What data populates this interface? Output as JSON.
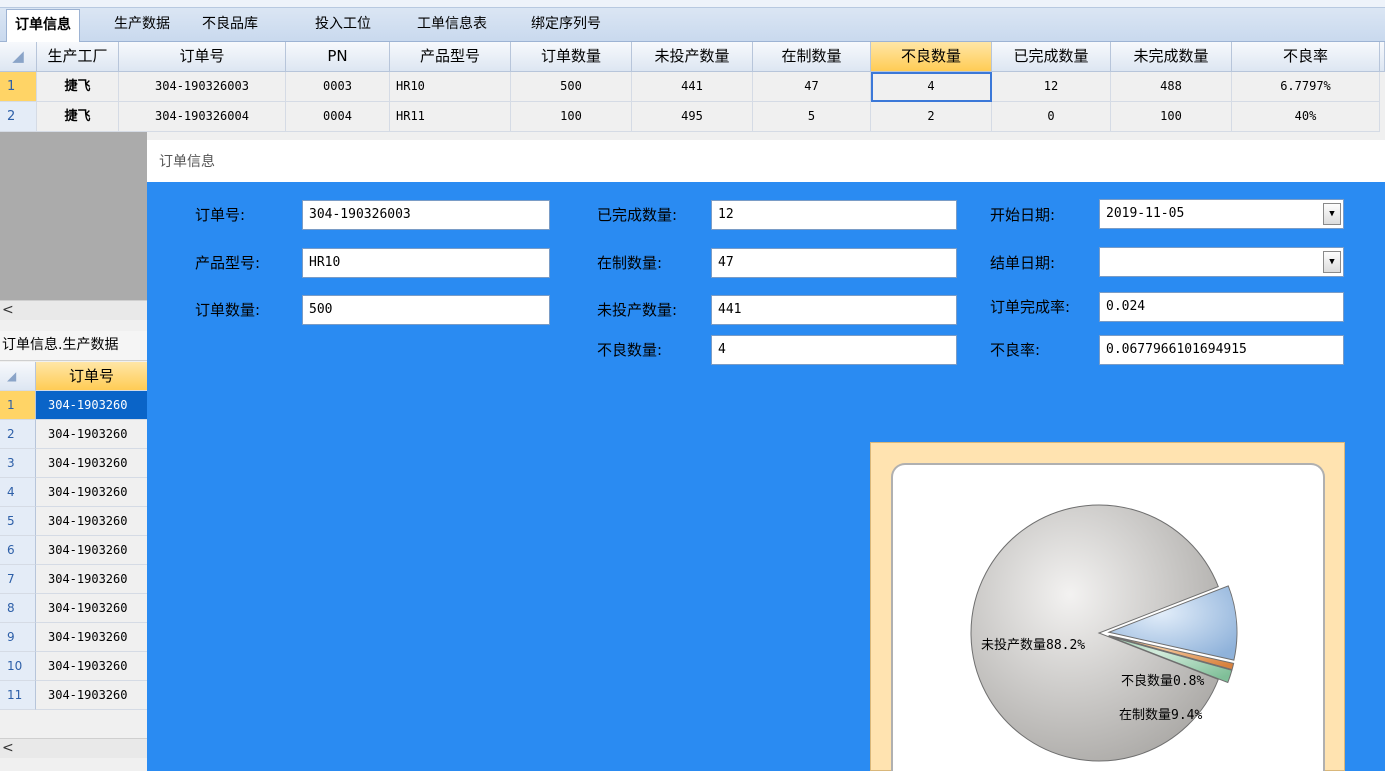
{
  "tabs": [
    "订单信息",
    "生产数据",
    "不良品库",
    "投入工位",
    "工单信息表",
    "绑定序列号"
  ],
  "top_grid": {
    "headers": [
      "生产工厂",
      "订单号",
      "PN",
      "产品型号",
      "订单数量",
      "未投产数量",
      "在制数量",
      "不良数量",
      "已完成数量",
      "未完成数量",
      "不良率"
    ],
    "rows": [
      {
        "num": "1",
        "cells": [
          "捷飞",
          "304-190326003",
          "0003",
          "HR10",
          "500",
          "441",
          "47",
          "4",
          "12",
          "488",
          "6.7797%"
        ]
      },
      {
        "num": "2",
        "cells": [
          "捷飞",
          "304-190326004",
          "0004",
          "HR11",
          "100",
          "495",
          "5",
          "2",
          "0",
          "100",
          "40%"
        ]
      }
    ]
  },
  "left_panel": {
    "caption": "订单信息.生产数据",
    "header": "订单号",
    "rows": [
      {
        "num": "1",
        "value": "304-1903260"
      },
      {
        "num": "2",
        "value": "304-1903260"
      },
      {
        "num": "3",
        "value": "304-1903260"
      },
      {
        "num": "4",
        "value": "304-1903260"
      },
      {
        "num": "5",
        "value": "304-1903260"
      },
      {
        "num": "6",
        "value": "304-1903260"
      },
      {
        "num": "7",
        "value": "304-1903260"
      },
      {
        "num": "8",
        "value": "304-1903260"
      },
      {
        "num": "9",
        "value": "304-1903260"
      },
      {
        "num": "10",
        "value": "304-1903260"
      },
      {
        "num": "11",
        "value": "304-1903260"
      }
    ],
    "scroll_left_glyph": "<"
  },
  "dialog": {
    "title": "订单信息",
    "fields": {
      "order_no": {
        "label": "订单号:",
        "value": "304-190326003"
      },
      "model": {
        "label": "产品型号:",
        "value": "HR10"
      },
      "order_qty": {
        "label": "订单数量:",
        "value": "500"
      },
      "done_qty": {
        "label": "已完成数量:",
        "value": "12"
      },
      "wip_qty": {
        "label": "在制数量:",
        "value": "47"
      },
      "unstarted_qty": {
        "label": "未投产数量:",
        "value": "441"
      },
      "defect_qty": {
        "label": "不良数量:",
        "value": "4"
      },
      "start_date": {
        "label": "开始日期:",
        "value": "2019-11-05"
      },
      "close_date": {
        "label": "结单日期:",
        "value": ""
      },
      "completion_rate": {
        "label": "订单完成率:",
        "value": "0.024"
      },
      "defect_rate": {
        "label": "不良率:",
        "value": "0.0677966101694915"
      }
    }
  },
  "chart_data": {
    "type": "pie",
    "slices": [
      {
        "label": "未投产数量",
        "value": 88.2,
        "text": "未投产数量88.2%",
        "color": "#d8d6d4"
      },
      {
        "label": "在制数量",
        "value": 9.4,
        "text": "在制数量9.4%",
        "color": "#b9d3ef"
      },
      {
        "label": "不良数量",
        "value": 0.8,
        "text": "不良数量0.8%",
        "color": "#e8a066"
      },
      {
        "label": "已完成数量",
        "value": 1.6,
        "text": "",
        "color": "#a6d4b8"
      }
    ]
  }
}
